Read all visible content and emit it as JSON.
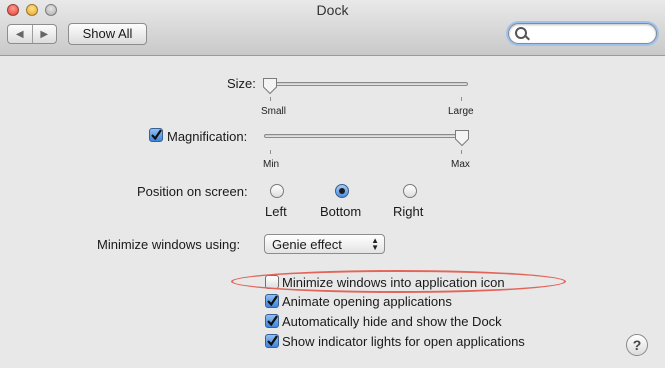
{
  "window": {
    "title": "Dock"
  },
  "toolbar": {
    "back_glyph": "◀",
    "forward_glyph": "▶",
    "show_all_label": "Show All",
    "search_placeholder": "",
    "search_value": ""
  },
  "size": {
    "label": "Size:",
    "min_label": "Small",
    "max_label": "Large",
    "value": 0.0
  },
  "magnification": {
    "label": "Magnification:",
    "checked": true,
    "min_label": "Min",
    "max_label": "Max",
    "value": 1.0
  },
  "position": {
    "label": "Position on screen:",
    "options": [
      {
        "label": "Left",
        "selected": false
      },
      {
        "label": "Bottom",
        "selected": true
      },
      {
        "label": "Right",
        "selected": false
      }
    ]
  },
  "minimize": {
    "label": "Minimize windows using:",
    "selected": "Genie effect",
    "arrows": "▲▼"
  },
  "options": [
    {
      "label": "Minimize windows into application icon",
      "checked": false
    },
    {
      "label": "Animate opening applications",
      "checked": true
    },
    {
      "label": "Automatically hide and show the Dock",
      "checked": true
    },
    {
      "label": "Show indicator lights for open applications",
      "checked": true
    }
  ],
  "help": {
    "glyph": "?"
  },
  "colors": {
    "accent": "#3f86dc",
    "highlight_oval": "#e36458"
  }
}
